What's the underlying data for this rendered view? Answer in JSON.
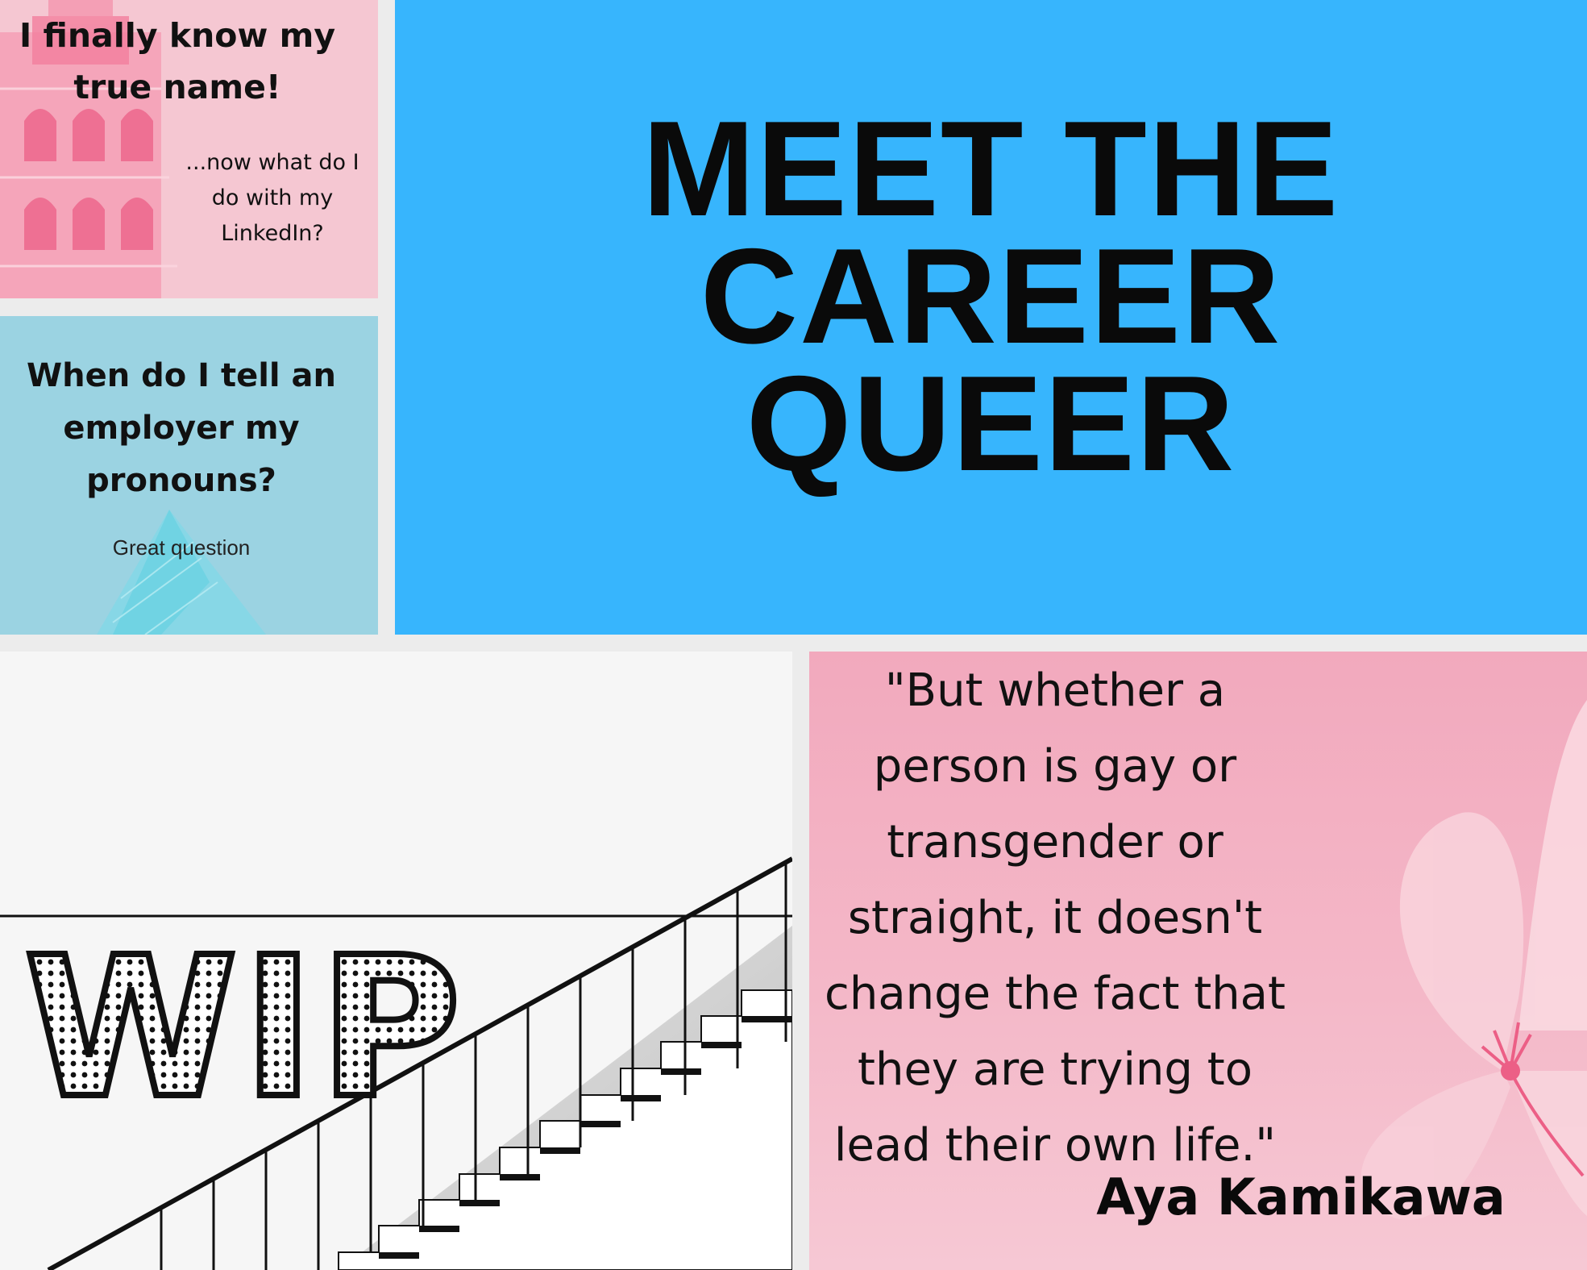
{
  "tiles": {
    "name": {
      "headline": "I finally know my true name!",
      "sub": "...now what do I do with my LinkedIn?"
    },
    "pronouns": {
      "headline": "When do I tell an employer my pronouns?",
      "sub": "Great question"
    },
    "title": {
      "line1": "MEET THE",
      "line2": "CAREER",
      "line3": "QUEER"
    },
    "wip": {
      "label": "WIP"
    },
    "quote": {
      "text": "\"But whether a person is gay or transgender or straight, it doesn't change the fact that they are trying to lead their own life.\"",
      "author": "Aya Kamikawa"
    }
  },
  "colors": {
    "pink_tile": "#f5c7d2",
    "blue_tile": "#9bd3e2",
    "title_blue": "#37b5fd",
    "quote_pink": "#f2a9bd",
    "gap": "#ececec"
  }
}
